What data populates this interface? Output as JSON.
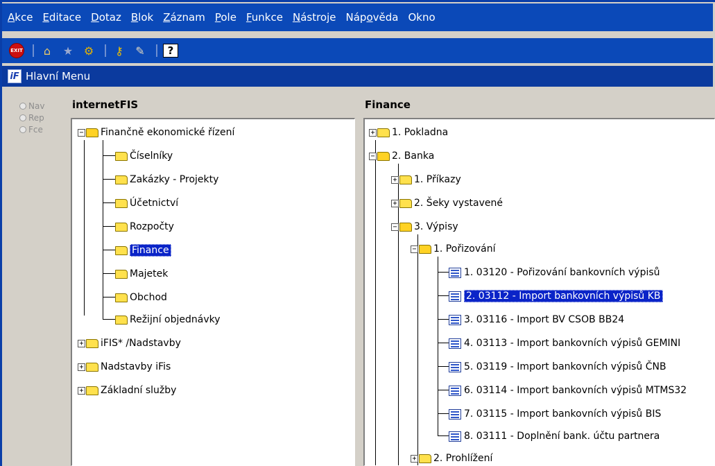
{
  "menu": [
    {
      "u": "A",
      "rest": "kce"
    },
    {
      "u": "E",
      "rest": "ditace"
    },
    {
      "u": "D",
      "rest": "otaz"
    },
    {
      "u": "B",
      "rest": "lok"
    },
    {
      "u": "Z",
      "rest": "áznam"
    },
    {
      "u": "P",
      "rest": "ole"
    },
    {
      "u": "F",
      "rest": "unkce"
    },
    {
      "u": "N",
      "rest": "ástroje"
    },
    {
      "pre": "Náp",
      "u": "o",
      "rest": "věda"
    },
    {
      "u": "",
      "rest": "Okno"
    }
  ],
  "toolbar": {
    "exit_label": "EXIT",
    "icons": [
      "exit-icon",
      "home-icon",
      "star-icon",
      "tree-icon",
      "key-icon",
      "wrench-icon",
      "help-icon"
    ]
  },
  "window": {
    "title": "Hlavní Menu",
    "icon_text": "iF"
  },
  "radios": [
    "Nav",
    "Rep",
    "Fce"
  ],
  "left": {
    "title": "internetFIS",
    "root": "Finančně ekonomické řízení",
    "children": [
      "Číselníky",
      "Zakázky - Projekty",
      "Účetnictví",
      "Rozpočty",
      "Finance",
      "Majetek",
      "Obchod",
      "Režijní objednávky"
    ],
    "selected": "Finance",
    "siblings": [
      "iFIS* /Nadstavby",
      "Nadstavby iFis",
      "Základní služby"
    ]
  },
  "right": {
    "title": "Finance",
    "n1": "1. Pokladna",
    "n2": "2. Banka",
    "n21": "1. Příkazy",
    "n22": "2. Šeky vystavené",
    "n23": "3. Výpisy",
    "n231": "1. Pořizování",
    "forms": [
      "1. 03120 - Pořizování bankovních výpisů",
      "2. 03112 - Import bankovních výpisů KB",
      "3. 03116 - Import BV CSOB BB24",
      "4. 03113 - Import bankovních výpisů GEMINI",
      "5. 03119 - Import bankovních výpisů ČNB",
      "6. 03114 - Import bankovních výpisů MTMS32",
      "7. 03115 - Import bankovních výpisů BIS",
      "8. 03111 - Doplnění bank. účtu partnera"
    ],
    "selected_form": "2. 03112 - Import bankovních výpisů KB",
    "n232": "2. Prohlížení"
  },
  "colors": {
    "menubar": "#0b49b8",
    "selection": "#0a24c8",
    "folder": "#ffe14d"
  }
}
